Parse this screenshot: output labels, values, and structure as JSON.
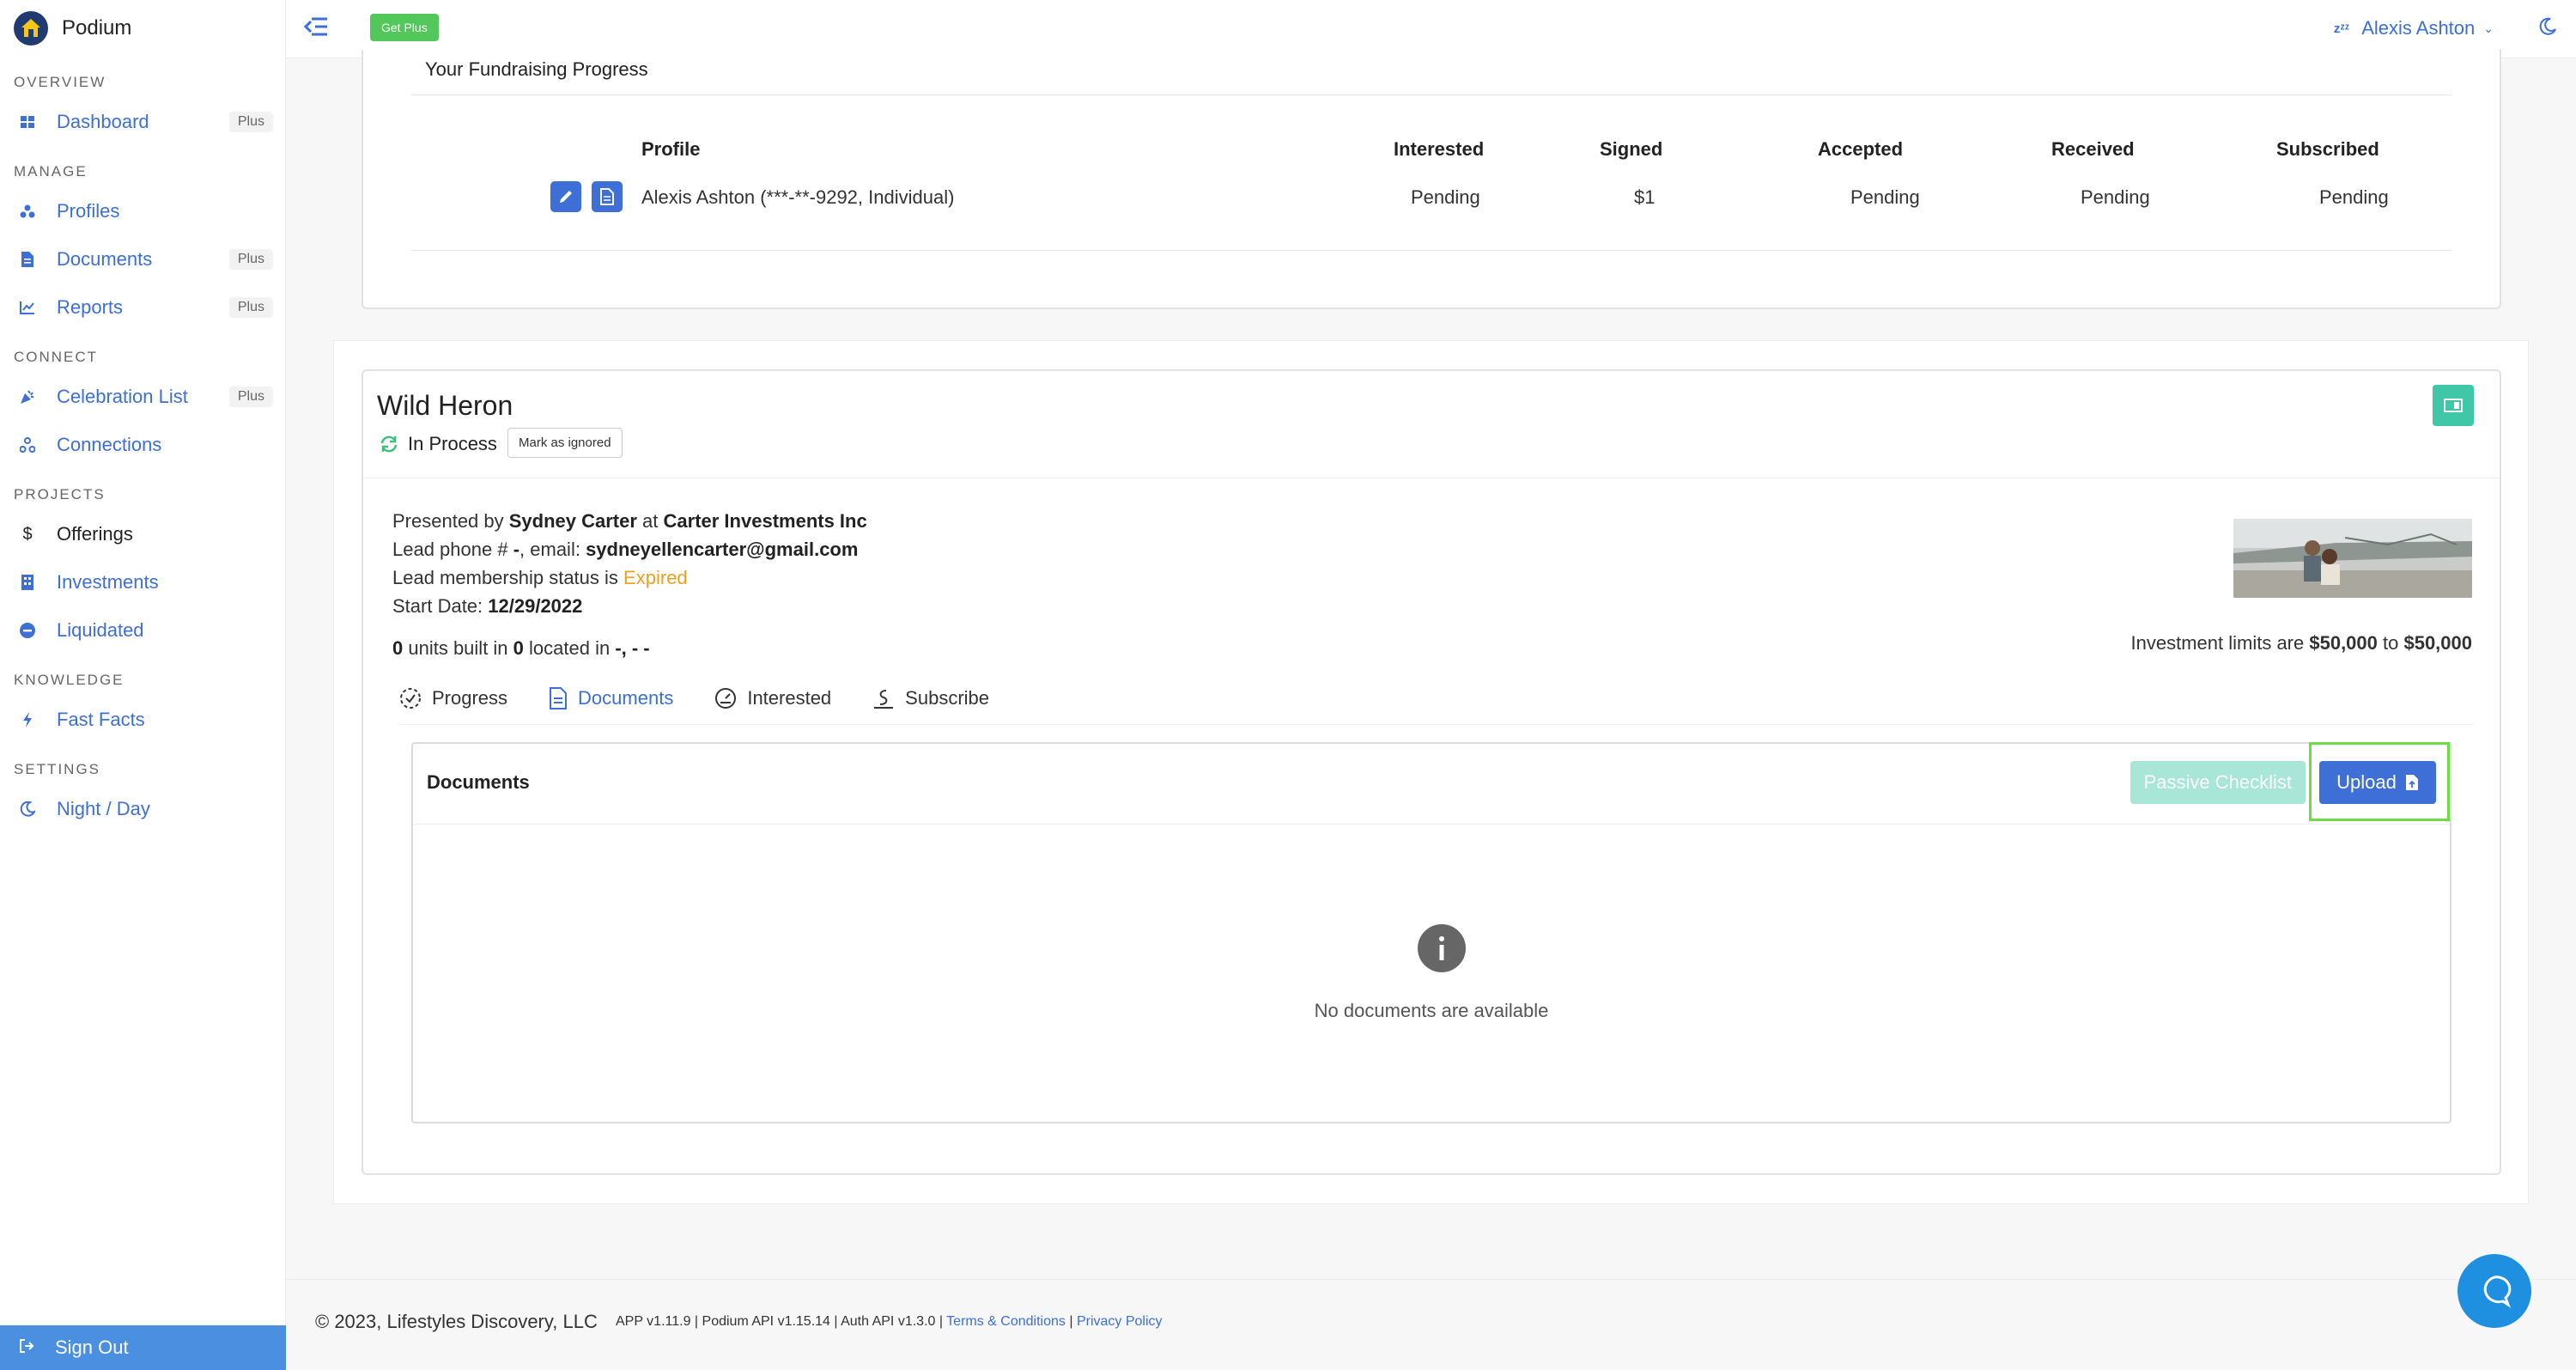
{
  "brand": {
    "name": "Podium"
  },
  "sidebar": {
    "sections": [
      {
        "title": "OVERVIEW"
      },
      {
        "title": "MANAGE"
      },
      {
        "title": "CONNECT"
      },
      {
        "title": "PROJECTS"
      },
      {
        "title": "KNOWLEDGE"
      },
      {
        "title": "SETTINGS"
      }
    ],
    "items": {
      "dashboard": {
        "label": "Dashboard",
        "badge": "Plus"
      },
      "profiles": {
        "label": "Profiles"
      },
      "documents": {
        "label": "Documents",
        "badge": "Plus"
      },
      "reports": {
        "label": "Reports",
        "badge": "Plus"
      },
      "celebration": {
        "label": "Celebration List",
        "badge": "Plus"
      },
      "connections": {
        "label": "Connections"
      },
      "offerings": {
        "label": "Offerings",
        "icon": "$"
      },
      "investments": {
        "label": "Investments"
      },
      "liquidated": {
        "label": "Liquidated"
      },
      "fastfacts": {
        "label": "Fast Facts"
      },
      "nightday": {
        "label": "Night / Day"
      }
    },
    "signout": "Sign Out"
  },
  "topbar": {
    "get_plus": "Get Plus",
    "user_name": "Alexis Ashton",
    "zz": "zᶻᶻ"
  },
  "progress": {
    "title": "Your Fundraising Progress",
    "headers": {
      "profile": "Profile",
      "interested": "Interested",
      "signed": "Signed",
      "accepted": "Accepted",
      "received": "Received",
      "subscribed": "Subscribed"
    },
    "row": {
      "profile": "Alexis Ashton (***-**-9292, Individual)",
      "interested": "Pending",
      "signed": "$1",
      "accepted": "Pending",
      "received": "Pending",
      "subscribed": "Pending"
    }
  },
  "offering": {
    "title": "Wild Heron",
    "status": "In Process",
    "mark_ignored": "Mark as ignored",
    "presented_prefix": "Presented by ",
    "presenter": "Sydney Carter",
    "at": " at ",
    "company": "Carter Investments Inc",
    "lead_phone_prefix": "Lead phone # ",
    "lead_phone": "-",
    "email_prefix": ", email: ",
    "email": "sydneyellencarter@gmail.com",
    "membership_prefix": "Lead membership status is ",
    "membership": "Expired",
    "start_prefix": "Start Date: ",
    "start_date": "12/29/2022",
    "units": "0",
    "units_mid": " units built in ",
    "located_count": "0",
    "located_mid": " located in ",
    "location": "-, - -",
    "limits_prefix": "Investment limits are ",
    "limit_min": "$50,000",
    "limits_to": " to ",
    "limit_max": "$50,000",
    "tabs": {
      "progress": "Progress",
      "documents": "Documents",
      "interested": "Interested",
      "subscribe": "Subscribe"
    },
    "docs": {
      "title": "Documents",
      "passive": "Passive Checklist",
      "upload": "Upload",
      "empty": "No documents are available"
    }
  },
  "footer": {
    "copyright": "© 2023, Lifestyles Discovery, LLC",
    "versions": "APP v1.11.9 | Podium API v1.15.14 | Auth API v1.3.0 | ",
    "terms": "Terms & Conditions",
    "sep": " | ",
    "privacy": "Privacy Policy"
  },
  "colors": {
    "accent": "#3d6fd6",
    "success": "#52c85a",
    "teal": "#3fc7a8",
    "warning": "#f0a020",
    "highlight": "#6ddc45"
  }
}
